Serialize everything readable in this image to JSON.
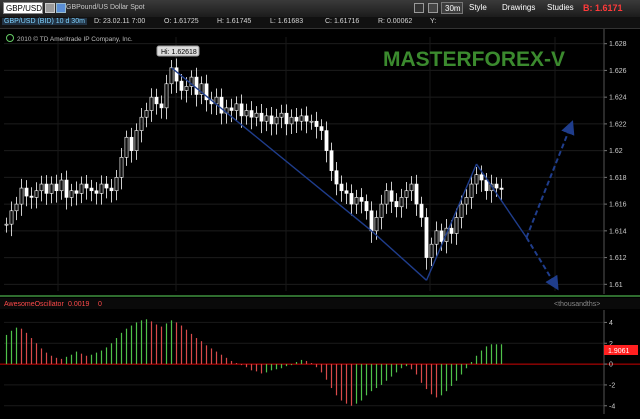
{
  "toolbar": {
    "symbol": "GBP/USD",
    "description": "GBPound/US Dollar Spot",
    "timeframe_label": "30m",
    "style_label": "Style",
    "drawings_label": "Drawings",
    "studies_label": "Studies",
    "quote_r": "B: 1.6171"
  },
  "infobar": {
    "symbol_tag": "GBP/USD (BID) 10 d 30m",
    "date": "D: 23.02.11 7:00",
    "open": "O: 1.61725",
    "high": "H: 1.61745",
    "low": "L: 1.61683",
    "close": "C: 1.61716",
    "range": "R: 0.00062",
    "y": "Y:"
  },
  "copyright": "2010 © TD Ameritrade IP Company, Inc.",
  "watermark": "MASTERFOREX-V",
  "hi_callout": "Hi: 1.62618",
  "colors": {
    "background": "#000000",
    "candles": "#ffffff",
    "pattern_lines": "#1f3d8c",
    "watermark": "#3b8a2e",
    "osc_up": "#4fc24a",
    "osc_down": "#d94a4a",
    "zero_line": "#cc0000",
    "price_marker": "#ff2020"
  },
  "chart_data": {
    "type": "candlestick",
    "price_axis": {
      "ticks": [
        "1.628",
        "1.626",
        "1.624",
        "1.622",
        "1.62",
        "1.618",
        "1.616",
        "1.614",
        "1.612",
        "1.61"
      ],
      "range": [
        1.6095,
        1.6285
      ]
    },
    "hi_value": 1.62618,
    "price_series": [
      1.6145,
      1.6155,
      1.616,
      1.6172,
      1.6166,
      1.6165,
      1.617,
      1.6175,
      1.6168,
      1.6175,
      1.617,
      1.6178,
      1.6165,
      1.617,
      1.6168,
      1.6175,
      1.6172,
      1.617,
      1.6168,
      1.6175,
      1.6172,
      1.617,
      1.618,
      1.6195,
      1.621,
      1.62,
      1.6215,
      1.6225,
      1.623,
      1.624,
      1.6235,
      1.6232,
      1.625,
      1.6262,
      1.6252,
      1.6245,
      1.6248,
      1.6255,
      1.6242,
      1.625,
      1.6238,
      1.6235,
      1.624,
      1.6228,
      1.6232,
      1.623,
      1.6235,
      1.6226,
      1.623,
      1.6225,
      1.6228,
      1.6222,
      1.6226,
      1.622,
      1.6225,
      1.6228,
      1.622,
      1.6225,
      1.6222,
      1.6226,
      1.6222,
      1.6222,
      1.6218,
      1.6215,
      1.62,
      1.6185,
      1.6175,
      1.617,
      1.6168,
      1.616,
      1.6165,
      1.6162,
      1.6155,
      1.614,
      1.615,
      1.616,
      1.617,
      1.6162,
      1.6158,
      1.6165,
      1.617,
      1.6175,
      1.616,
      1.615,
      1.612,
      1.613,
      1.614,
      1.6132,
      1.6142,
      1.6138,
      1.615,
      1.616,
      1.6165,
      1.6175,
      1.6182,
      1.6178,
      1.617,
      1.6175,
      1.6172,
      1.6171
    ],
    "pattern_points": [
      {
        "index": 33,
        "price": 1.6262
      },
      {
        "index": 73,
        "price": 1.614
      },
      {
        "index": 84,
        "price": 1.6103
      },
      {
        "index": 94,
        "price": 1.619
      },
      {
        "index": 104,
        "price": 1.6135
      }
    ],
    "projections": [
      {
        "from": {
          "index": 104,
          "price": 1.6135
        },
        "to": {
          "index": 113,
          "price": 1.622
        },
        "style": "dashed"
      },
      {
        "from": {
          "index": 104,
          "price": 1.6135
        },
        "to": {
          "index": 110,
          "price": 1.6098
        },
        "style": "dashed"
      }
    ],
    "oscillator": {
      "name": "AwesomeOscillator",
      "value_label": "0.0019",
      "extra_label": "0",
      "unit_label": "<thousandths>",
      "ticks": [
        "4",
        "2",
        "0",
        "-2",
        "-4"
      ],
      "range": [
        -4.6,
        5.0
      ],
      "current_label": "1.9061",
      "values": [
        2.8,
        3.2,
        3.5,
        3.4,
        3.0,
        2.5,
        2.0,
        1.5,
        1.1,
        0.8,
        0.6,
        0.5,
        0.7,
        0.9,
        1.2,
        1.0,
        0.8,
        0.9,
        1.1,
        1.3,
        1.6,
        2.0,
        2.5,
        3.0,
        3.4,
        3.7,
        4.0,
        4.2,
        4.3,
        4.1,
        3.8,
        3.6,
        3.9,
        4.2,
        4.0,
        3.7,
        3.3,
        2.9,
        2.5,
        2.2,
        1.8,
        1.5,
        1.2,
        0.9,
        0.6,
        0.3,
        0.1,
        -0.1,
        -0.3,
        -0.6,
        -0.7,
        -0.9,
        -0.8,
        -0.6,
        -0.5,
        -0.4,
        -0.2,
        -0.1,
        0.2,
        0.4,
        0.3,
        0.1,
        -0.3,
        -0.8,
        -1.5,
        -2.3,
        -3.0,
        -3.5,
        -3.8,
        -4.0,
        -3.8,
        -3.5,
        -3.0,
        -2.6,
        -2.3,
        -2.0,
        -1.6,
        -1.2,
        -0.8,
        -0.4,
        -0.2,
        -0.5,
        -1.0,
        -1.8,
        -2.4,
        -2.9,
        -3.2,
        -3.0,
        -2.6,
        -2.1,
        -1.6,
        -1.0,
        -0.4,
        0.2,
        0.8,
        1.3,
        1.7,
        1.9,
        1.9,
        1.9
      ]
    }
  }
}
